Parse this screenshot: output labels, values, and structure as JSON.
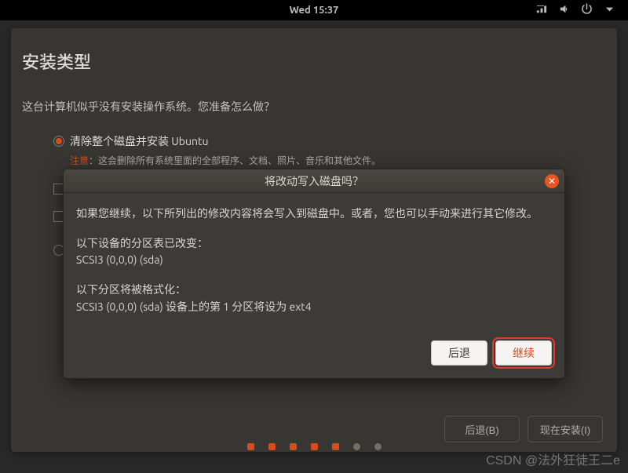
{
  "topbar": {
    "time": "Wed 15:37"
  },
  "installer": {
    "title": "安装类型",
    "intro": "这台计算机似乎没有安装操作系统。您准备怎么做？",
    "options": [
      {
        "label": "清除整个磁盘并安装 Ubuntu",
        "warn": "注意",
        "note": "：这会删除所有系统里面的全部程序、文档、照片、音乐和其他文件。"
      }
    ],
    "back": "后退(B)",
    "install": "现在安装(I)"
  },
  "dialog": {
    "title": "将改动写入磁盘吗？",
    "intro": "如果您继续，以下所列出的修改内容将会写入到磁盘中。或者，您也可以手动来进行其它修改。",
    "section1_heading": "以下设备的分区表已改变：",
    "section1_line": "SCSI3 (0,0,0) (sda)",
    "section2_heading": "以下分区将被格式化：",
    "section2_line": "SCSI3 (0,0,0) (sda) 设备上的第 1 分区将设为 ext4",
    "back": "后退",
    "continue": "继续"
  },
  "watermark": "CSDN @法外狂徒王二e"
}
